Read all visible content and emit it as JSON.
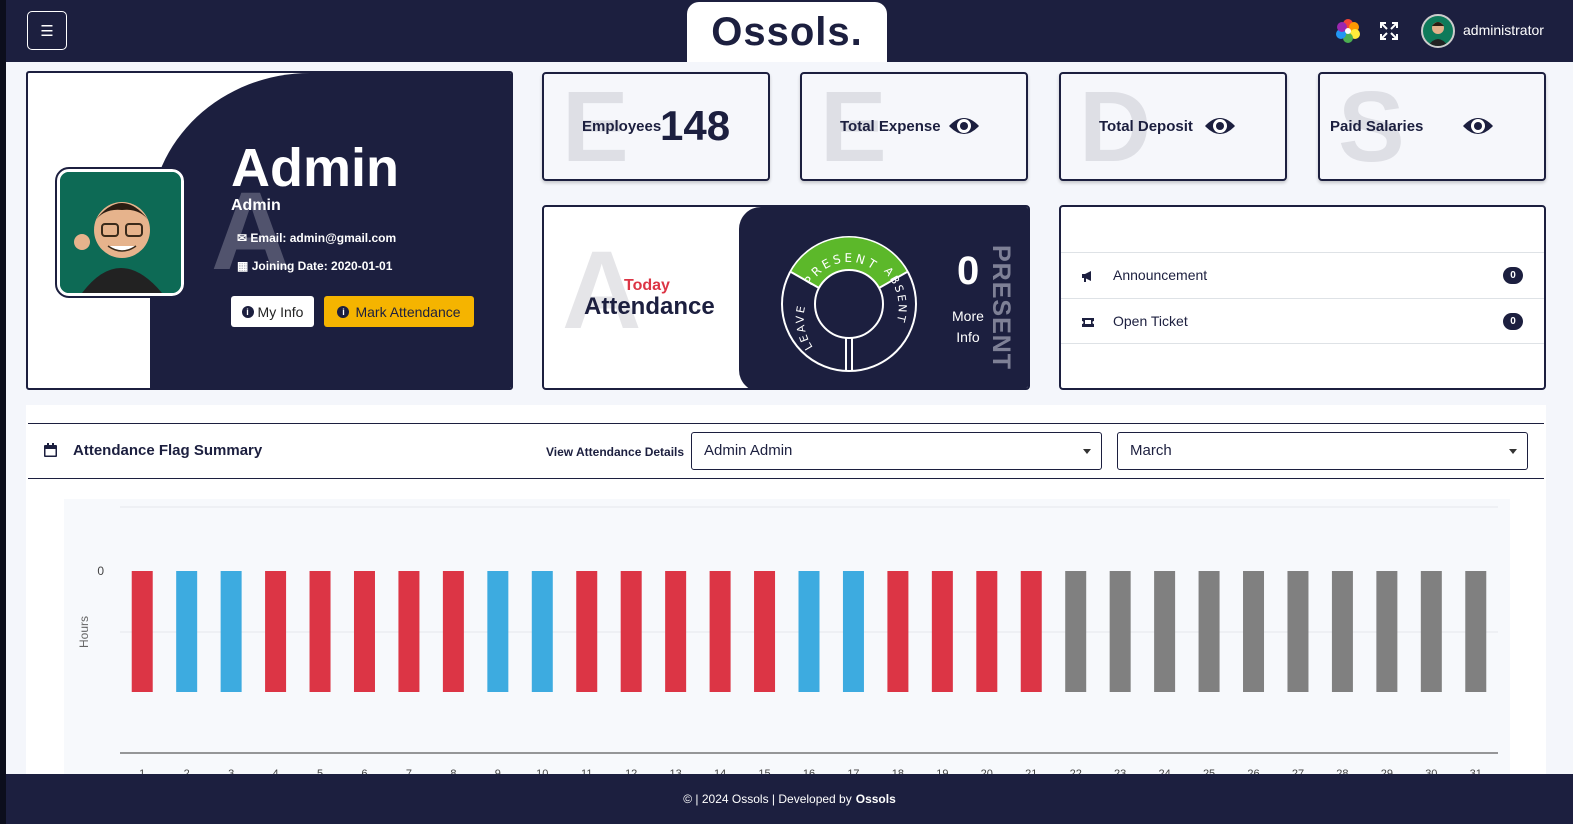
{
  "header": {
    "menu_icon": "hamburger-icon",
    "logo": "Ossols.",
    "username": "administrator"
  },
  "profile": {
    "ghost_letter": "A",
    "title": "Admin",
    "subtitle": "Admin",
    "email": "Email: admin@gmail.com",
    "joining_date": "Joining Date: 2020-01-01",
    "my_info_label": "My Info",
    "mark_attendance_label": "Mark Attendance"
  },
  "stats": [
    {
      "ghost": "E",
      "label": "Employees",
      "value": "148"
    },
    {
      "ghost": "E",
      "label": "Total Expense",
      "value": ""
    },
    {
      "ghost": "D",
      "label": "Total Deposit",
      "value": ""
    },
    {
      "ghost": "S",
      "label": "Paid Salaries",
      "value": ""
    }
  ],
  "attendance": {
    "ghost_letter": "A",
    "today_label": "Today",
    "title": "Attendance",
    "wheel_present": "PRESENT",
    "wheel_absent": "ABSENT",
    "wheel_leave": "LEAVE",
    "count": "0",
    "more_label": "More",
    "info_label": "Info",
    "vertical_label": "PRESENT"
  },
  "notices": {
    "items": [
      {
        "label": "Announcement",
        "count": "0",
        "icon": "megaphone-icon"
      },
      {
        "label": "Open Ticket",
        "count": "0",
        "icon": "ticket-icon"
      }
    ]
  },
  "summary": {
    "title": "Attendance Flag Summary",
    "view_label": "View Attendance Details",
    "employee_select": "Admin Admin",
    "month_select": "March"
  },
  "chart_data": {
    "type": "bar",
    "categories": [
      "1",
      "2",
      "3",
      "4",
      "5",
      "6",
      "7",
      "8",
      "9",
      "10",
      "11",
      "12",
      "13",
      "14",
      "15",
      "16",
      "17",
      "18",
      "19",
      "20",
      "21",
      "22",
      "23",
      "24",
      "25",
      "26",
      "27",
      "28",
      "29",
      "30",
      "31"
    ],
    "values": [
      0,
      0,
      0,
      0,
      0,
      0,
      0,
      0,
      0,
      0,
      0,
      0,
      0,
      0,
      0,
      0,
      0,
      0,
      0,
      0,
      0,
      0,
      0,
      0,
      0,
      0,
      0,
      0,
      0,
      0,
      0
    ],
    "flags": [
      "absent",
      "leave",
      "leave",
      "absent",
      "absent",
      "absent",
      "absent",
      "absent",
      "leave",
      "leave",
      "absent",
      "absent",
      "absent",
      "absent",
      "absent",
      "leave",
      "leave",
      "absent",
      "absent",
      "absent",
      "absent",
      "none",
      "none",
      "none",
      "none",
      "none",
      "none",
      "none",
      "none",
      "none",
      "none"
    ],
    "flag_colors": {
      "absent": "#dc3545",
      "leave": "#3dabe0",
      "none": "#808080"
    },
    "ylabel": "Hours",
    "ytick": "0",
    "grid": true
  },
  "footer": {
    "text": "© | 2024 Ossols | Developed by",
    "brand": "Ossols"
  },
  "colors": {
    "primary": "#1c1f3f",
    "warning": "#f5b400",
    "danger": "#dc3545",
    "info": "#3dabe0",
    "success": "#5cb82a"
  }
}
